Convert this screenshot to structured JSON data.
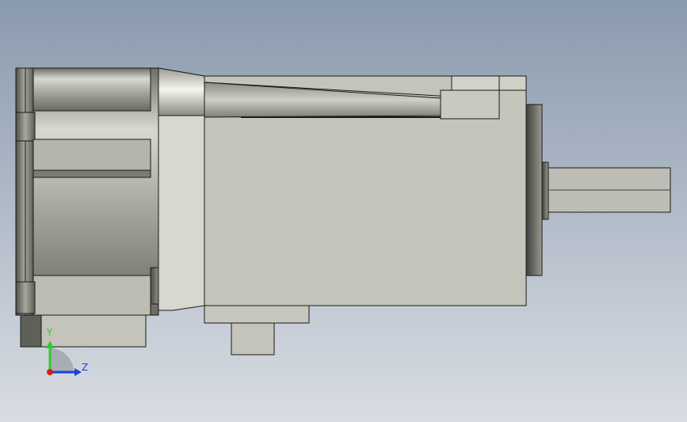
{
  "viewport": {
    "background_top": "#8a9aae",
    "background_bottom": "#d9dde3"
  },
  "model": {
    "body_color": "#c4c4bb",
    "edge_color": "#1a1a1a",
    "shaft_color": "#bdbdb5"
  },
  "triad": {
    "y_label": "Y",
    "z_label": "Z",
    "y_color": "#2ecc2e",
    "z_color": "#1f3fd8",
    "x_color": "#d02020"
  }
}
